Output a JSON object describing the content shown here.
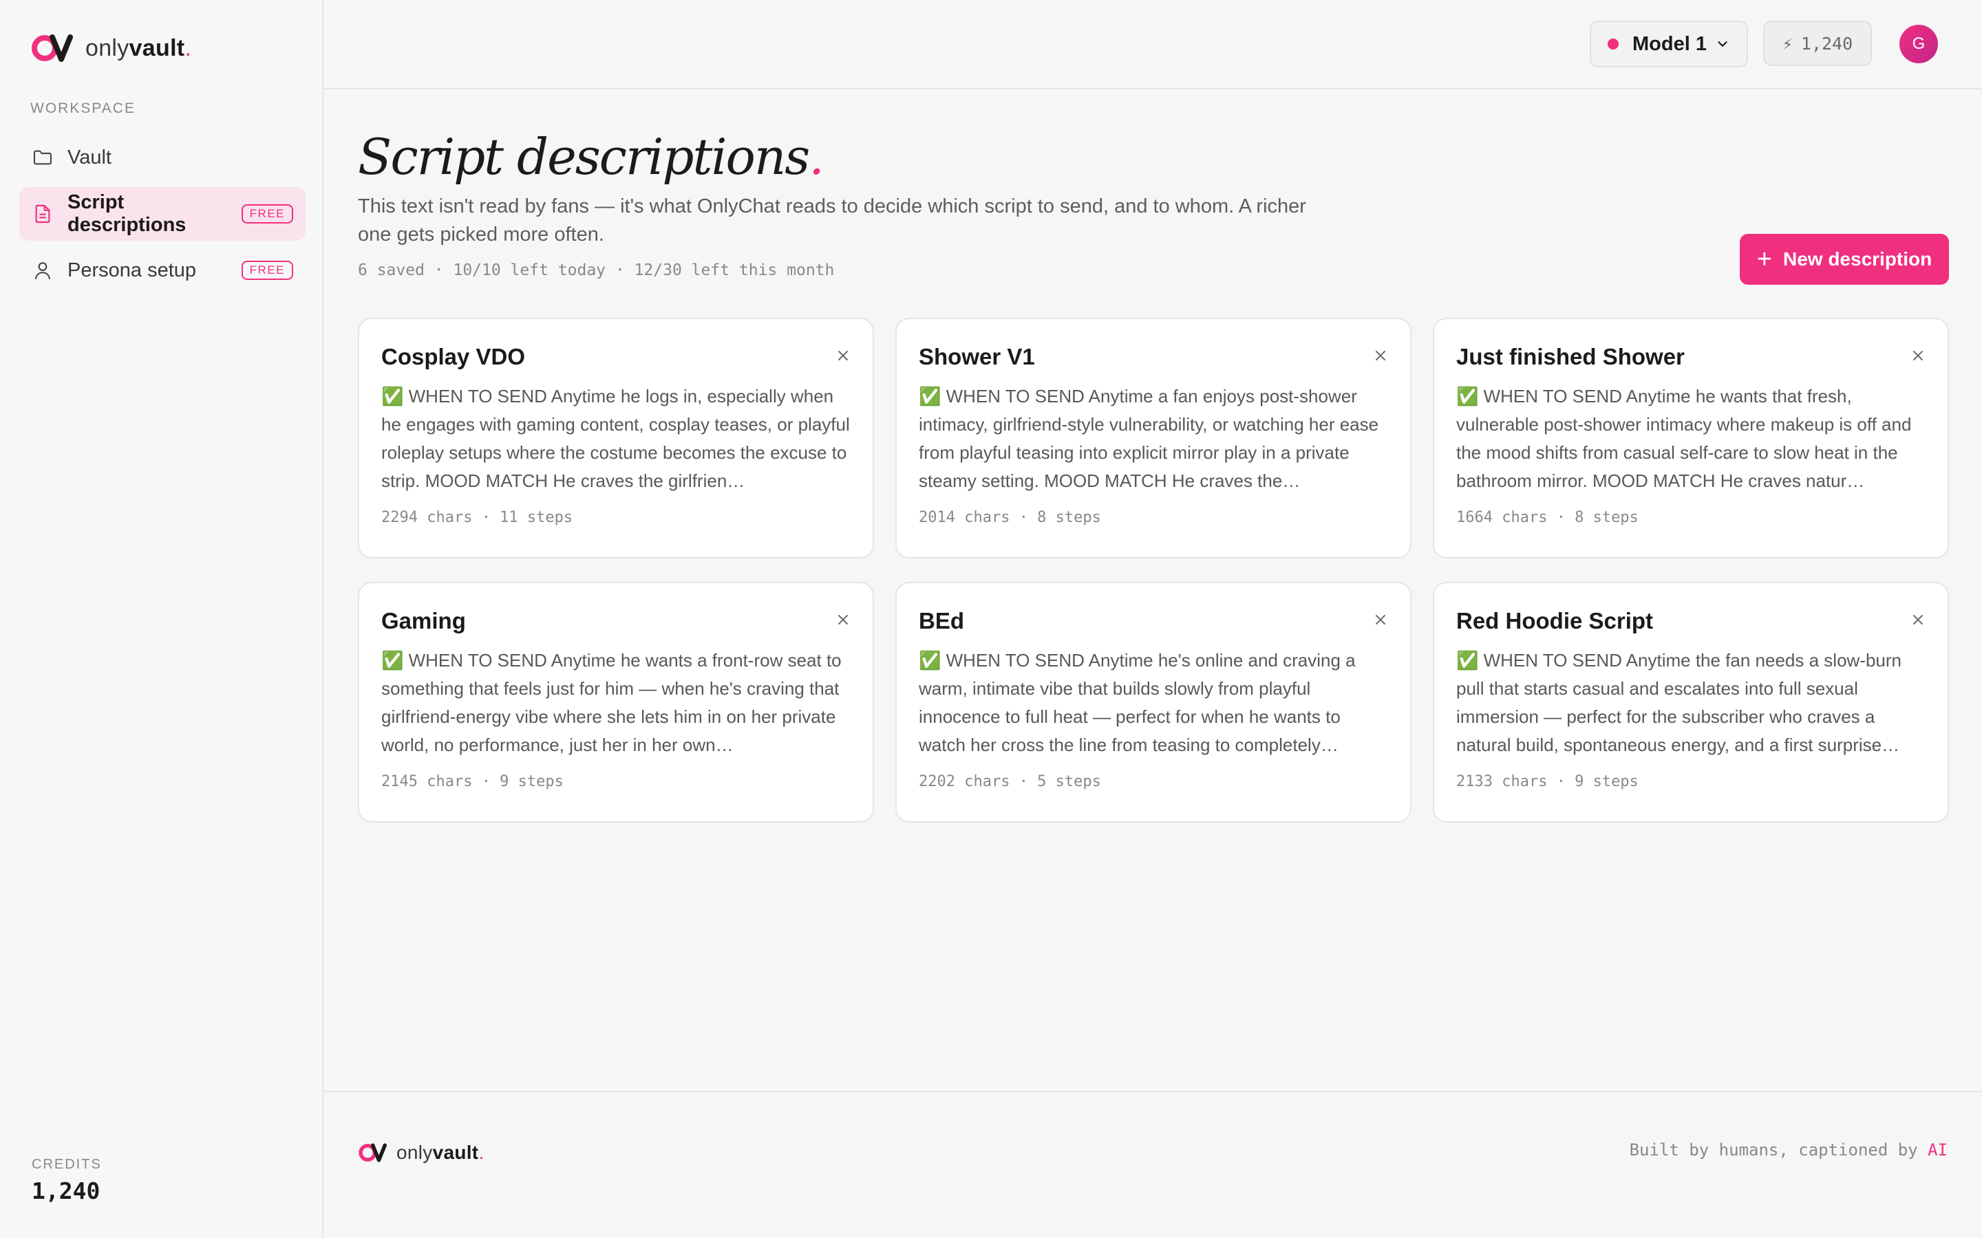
{
  "brand": {
    "name_light": "only",
    "name_bold": "vault",
    "dot": "."
  },
  "sidebar": {
    "section_label": "WORKSPACE",
    "items": [
      {
        "label": "Vault",
        "icon": "folder-icon",
        "badge": "",
        "active": false
      },
      {
        "label": "Script descriptions",
        "icon": "document-icon",
        "badge": "FREE",
        "active": true
      },
      {
        "label": "Persona setup",
        "icon": "user-icon",
        "badge": "FREE",
        "active": false
      }
    ],
    "credits_label": "CREDITS",
    "credits_value": "1,240"
  },
  "topbar": {
    "model_label": "Model 1",
    "credits": "1,240",
    "avatar_initial": "G"
  },
  "main": {
    "title": "Script descriptions",
    "title_dot": ".",
    "description": "This text isn't read by fans — it's what OnlyChat reads to decide which script to send, and to whom. A richer one gets picked more often.",
    "meta": "6 saved · 10/10 left today · 12/30 left this month",
    "new_button": "New description",
    "cards": [
      {
        "title": "Cosplay VDO",
        "body": "✅ WHEN TO SEND Anytime he logs in, especially when he engages with gaming content, cosplay teases, or playful roleplay setups where the costume becomes the excuse to strip. MOOD MATCH He craves the girlfrien…",
        "meta": "2294 chars · 11 steps"
      },
      {
        "title": "Shower V1",
        "body": "✅ WHEN TO SEND Anytime a fan enjoys post-shower intimacy, girlfriend-style vulnerability, or watching her ease from playful teasing into explicit mirror play in a private steamy setting. MOOD MATCH He craves the…",
        "meta": "2014 chars · 8 steps"
      },
      {
        "title": "Just finished Shower",
        "body": "✅ WHEN TO SEND Anytime he wants that fresh, vulnerable post-shower intimacy where makeup is off and the mood shifts from casual self-care to slow heat in the bathroom mirror. MOOD MATCH He craves natur…",
        "meta": "1664 chars · 8 steps"
      },
      {
        "title": "Gaming",
        "body": "✅ WHEN TO SEND Anytime he wants a front-row seat to something that feels just for him — when he's craving that girlfriend-energy vibe where she lets him in on her private world, no performance, just her in her own…",
        "meta": "2145 chars · 9 steps"
      },
      {
        "title": "BEd",
        "body": "✅ WHEN TO SEND Anytime he's online and craving a warm, intimate vibe that builds slowly from playful innocence to full heat — perfect for when he wants to watch her cross the line from teasing to completely…",
        "meta": "2202 chars · 5 steps"
      },
      {
        "title": "Red Hoodie Script",
        "body": "✅ WHEN TO SEND Anytime the fan needs a slow-burn pull that starts casual and escalates into full sexual immersion — perfect for the subscriber who craves a natural build, spontaneous energy, and a first surprise…",
        "meta": "2133 chars · 9 steps"
      }
    ]
  },
  "footer": {
    "credit_text": "Built by humans, captioned by ",
    "credit_highlight": "AI"
  },
  "colors": {
    "accent": "#f0307f",
    "background": "#f7f6f6",
    "card": "#ffffff"
  }
}
